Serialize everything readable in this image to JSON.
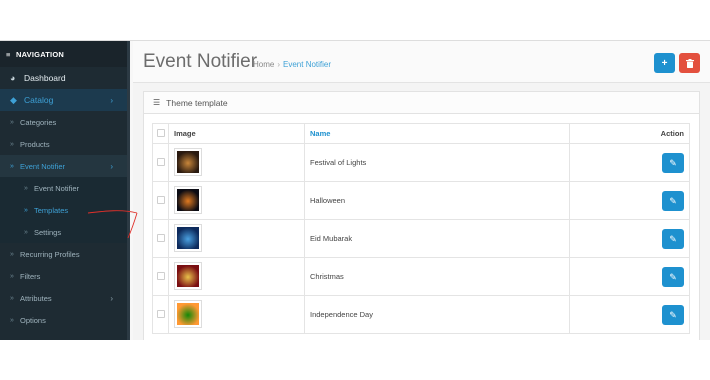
{
  "sidebar": {
    "heading": "NAVIGATION",
    "items": [
      {
        "label": "Dashboard",
        "icon": "dashboard-icon"
      },
      {
        "label": "Catalog",
        "icon": "tag-icon"
      },
      {
        "label": "Categories"
      },
      {
        "label": "Products"
      },
      {
        "label": "Event Notifier"
      },
      {
        "label": "Event Notifier"
      },
      {
        "label": "Templates"
      },
      {
        "label": "Settings"
      },
      {
        "label": "Recurring Profiles"
      },
      {
        "label": "Filters"
      },
      {
        "label": "Attributes"
      },
      {
        "label": "Options"
      }
    ]
  },
  "header": {
    "title": "Event Notifier",
    "breadcrumb": {
      "home": "Home",
      "separator": "›",
      "current": "Event Notifier"
    },
    "add_icon": "+",
    "delete_icon": "🗑"
  },
  "panel": {
    "title": "Theme template",
    "columns": {
      "image": "Image",
      "name": "Name",
      "action": "Action"
    },
    "rows": [
      {
        "name": "Festival of Lights",
        "thumb_colors": [
          "#2a1a10",
          "#c8863a"
        ]
      },
      {
        "name": "Halloween",
        "thumb_colors": [
          "#0c0c14",
          "#e07a20"
        ]
      },
      {
        "name": "Eid Mubarak",
        "thumb_colors": [
          "#0d2a5c",
          "#4aa0e0"
        ]
      },
      {
        "name": "Christmas",
        "thumb_colors": [
          "#7a0e12",
          "#e8c04a"
        ]
      },
      {
        "name": "Independence Day",
        "thumb_colors": [
          "#ff9933",
          "#138808"
        ]
      }
    ]
  },
  "colors": {
    "accent": "#1e91cf",
    "danger": "#e3503e",
    "sidebar": "#1e2b33"
  }
}
